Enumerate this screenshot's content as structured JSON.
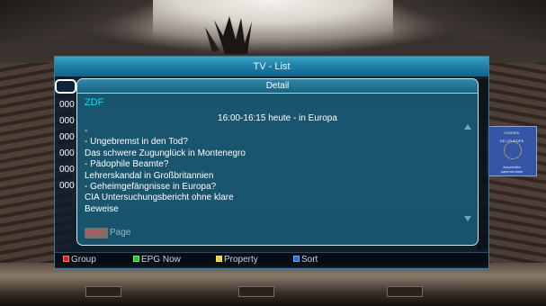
{
  "window": {
    "title": "TV - List"
  },
  "channels": [
    "000",
    "000",
    "000",
    "000",
    "000",
    "000"
  ],
  "detail": {
    "title": "Detail",
    "channel": "ZDF",
    "event": "16:00-16:15  heute - in Europa",
    "description": [
      "-",
      "- Ungebremst in den Tod?",
      "Das schwere Zugunglück in Montenegro",
      "- Pädophile Beamte?",
      "Lehrerskandal in Großbritannien",
      "- Geheimgefängnisse in Europa?",
      "CIA Untersuchungsbericht ohne klare",
      "Beweise"
    ],
    "pip_key": "PiP+",
    "pip_label": "Page"
  },
  "buttons": {
    "group": {
      "label": "Group",
      "color": "#e02020"
    },
    "epg_now": {
      "label": "EPG Now",
      "color": "#2fc42f"
    },
    "property": {
      "label": "Property",
      "color": "#e8d21a"
    },
    "sort": {
      "label": "Sort",
      "color": "#2a6ae6"
    }
  },
  "background": {
    "sign_text": [
      "CONSEIL",
      "DE L'EUROPE",
      "",
      "",
      "",
      "Assemblée",
      "parlementaire"
    ]
  }
}
